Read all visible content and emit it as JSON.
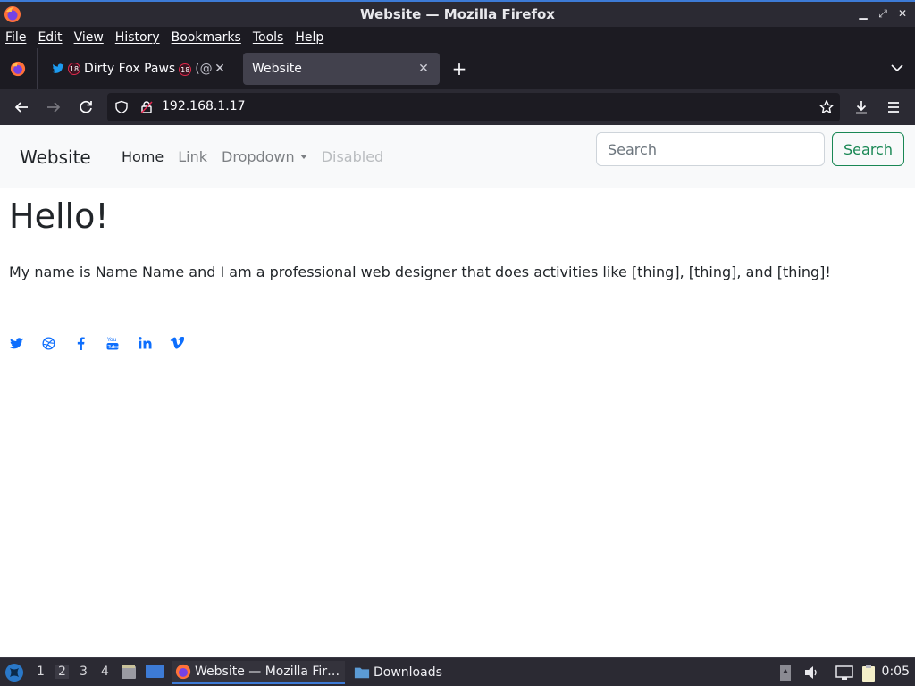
{
  "window": {
    "title": "Website — Mozilla Firefox",
    "controls": [
      "minimize",
      "restore",
      "close"
    ]
  },
  "menubar": [
    "File",
    "Edit",
    "View",
    "History",
    "Bookmarks",
    "Tools",
    "Help"
  ],
  "tabs": [
    {
      "title": "Dirty Fox Paws",
      "title_suffix": "(@fo",
      "badge": "18",
      "icon": "twitter-bird-icon",
      "active": false
    },
    {
      "title": "Website",
      "active": true
    }
  ],
  "urlbar": {
    "url": "192.168.1.17"
  },
  "page": {
    "brand": "Website",
    "nav": {
      "home": "Home",
      "link": "Link",
      "dropdown": "Dropdown",
      "disabled": "Disabled"
    },
    "search": {
      "placeholder": "Search",
      "button": "Search"
    },
    "heading": "Hello!",
    "intro": "My name is Name Name and I am a professional web designer that does activities like [thing], [thing], and [thing]!",
    "socials": [
      "twitter",
      "dribbble",
      "facebook",
      "youtube",
      "linkedin",
      "vimeo"
    ],
    "social_color": "#0d6efd"
  },
  "taskbar": {
    "workspaces": [
      "1",
      "2",
      "3",
      "4"
    ],
    "current_workspace": "2",
    "apps": [
      {
        "label": "Website — Mozilla Fir…",
        "active": true
      },
      {
        "label": "Downloads",
        "active": false
      }
    ],
    "clock": "0:05"
  },
  "colors": {
    "accent": "#3d7bd6",
    "success": "#198754",
    "chrome_dark": "#1c1b22"
  }
}
